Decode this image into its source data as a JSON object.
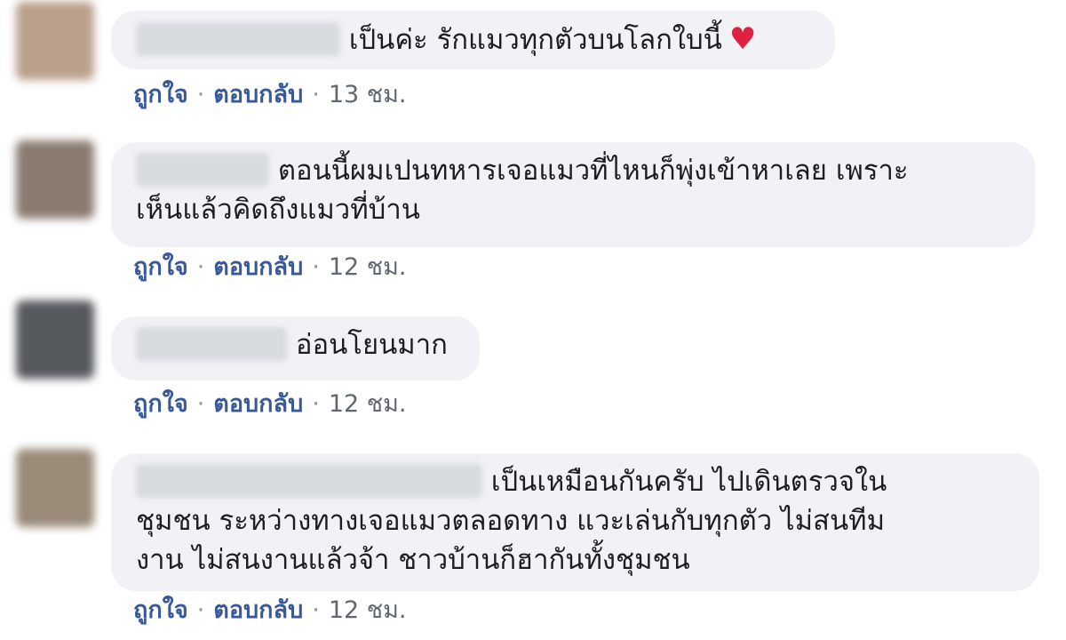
{
  "comments": [
    {
      "text": "เป็นค่ะ รักแมวทุกตัวบนโลกใบนี้",
      "heart": "♥",
      "like_label": "ถูกใจ",
      "reply_label": "ตอบกลับ",
      "time": "13 ชม."
    },
    {
      "text_line1": "ตอนนี้ผมเปนทหารเจอแมวที่ไหนก็พุ่งเข้าหาเลย เพราะ",
      "text_line2": "เห็นแล้วคิดถึงแมวที่บ้าน",
      "like_label": "ถูกใจ",
      "reply_label": "ตอบกลับ",
      "time": "12 ชม."
    },
    {
      "text": "อ่อนโยนมาก",
      "like_label": "ถูกใจ",
      "reply_label": "ตอบกลับ",
      "time": "12 ชม."
    },
    {
      "text_line1": "เป็นเหมือนกันครับ ไปเดินตรวจใน",
      "text_line2": "ชุมชน ระหว่างทางเจอแมวตลอดทาง แวะเล่นกับทุกตัว ไม่สนทีม",
      "text_line3": "งาน ไม่สนงานแล้วจ้า ชาวบ้านก็ฮากันทั้งชุมชน",
      "like_label": "ถูกใจ",
      "reply_label": "ตอบกลับ",
      "time": "12 ชม."
    }
  ],
  "separator": "·",
  "colors": {
    "bubble_bg": "#f0f2f5",
    "link": "#385898",
    "muted": "#8d949e",
    "heart": "#e02040"
  }
}
